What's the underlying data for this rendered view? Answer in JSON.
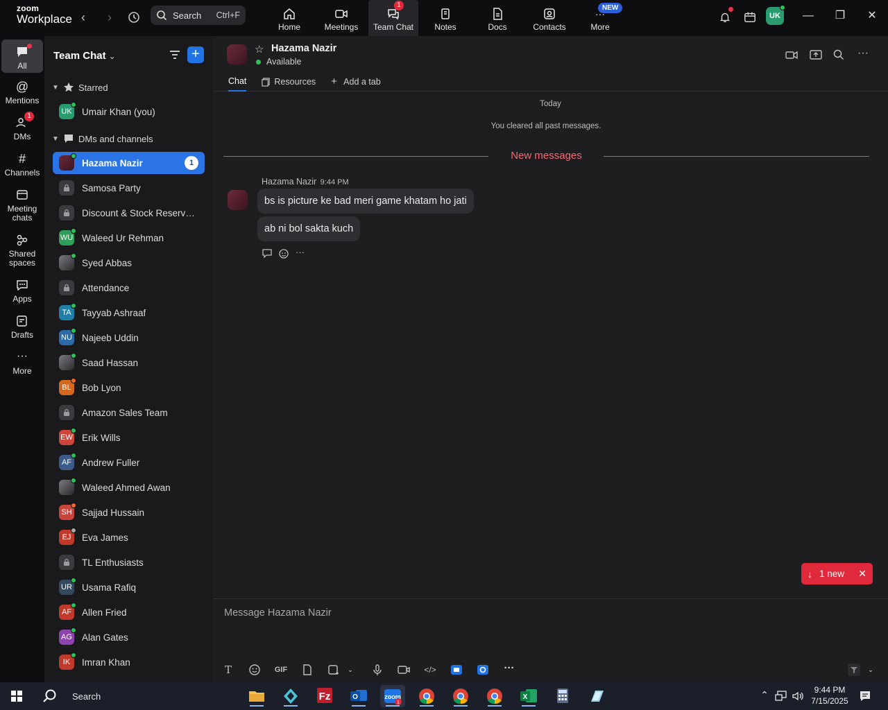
{
  "app": {
    "brand_line1": "zoom",
    "brand_line2": "Workplace"
  },
  "topbar": {
    "search_label": "Search",
    "search_shortcut": "Ctrl+F",
    "nav": [
      {
        "label": "Home",
        "icon": "home-icon"
      },
      {
        "label": "Meetings",
        "icon": "video-camera-icon"
      },
      {
        "label": "Team Chat",
        "icon": "chat-bubbles-icon",
        "badge": "1",
        "active": true
      },
      {
        "label": "Notes",
        "icon": "notes-icon"
      },
      {
        "label": "Docs",
        "icon": "document-icon"
      },
      {
        "label": "Contacts",
        "icon": "contacts-icon"
      },
      {
        "label": "More",
        "icon": "more-icon",
        "pill": "NEW"
      }
    ],
    "avatar_initials": "UK"
  },
  "rail": [
    {
      "label": "All",
      "icon": "chat-icon",
      "active": true
    },
    {
      "label": "Mentions",
      "icon": "at-icon"
    },
    {
      "label": "DMs",
      "icon": "people-icon",
      "badge": "1"
    },
    {
      "label": "Channels",
      "icon": "hash-icon"
    },
    {
      "label": "Meeting chats",
      "icon": "calendar-icon"
    },
    {
      "label": "Shared spaces",
      "icon": "shared-spaces-icon"
    },
    {
      "label": "Apps",
      "icon": "apps-icon"
    },
    {
      "label": "Drafts",
      "icon": "drafts-icon"
    },
    {
      "label": "More",
      "icon": "ellipsis-icon"
    }
  ],
  "channel_list": {
    "title": "Team Chat",
    "sections": {
      "starred": "Starred",
      "dms": "DMs and channels"
    },
    "starred": [
      {
        "name": "Umair Khan (you)",
        "initials": "UK",
        "color": "#2a9b6f",
        "status": "online"
      }
    ],
    "items": [
      {
        "name": "Hazama Nazir",
        "initials": "",
        "color": "#5a2231",
        "status": "online",
        "count": "1",
        "selected": true
      },
      {
        "name": "Samosa Party",
        "type": "lock"
      },
      {
        "name": "Discount & Stock Reservati...",
        "type": "lock"
      },
      {
        "name": "Waleed Ur Rehman",
        "initials": "WU",
        "color": "#2f9e5a",
        "status": "online"
      },
      {
        "name": "Syed Abbas",
        "initials": "",
        "color": "#333",
        "status": "online",
        "photo": true
      },
      {
        "name": "Attendance",
        "type": "lock"
      },
      {
        "name": "Tayyab Ashraaf",
        "initials": "TA",
        "color": "#1f7fa8",
        "status": "online"
      },
      {
        "name": "Najeeb Uddin",
        "initials": "NU",
        "color": "#2c6aa8",
        "status": "online"
      },
      {
        "name": "Saad Hassan",
        "initials": "",
        "color": "#3f3a45",
        "status": "online",
        "photo": true
      },
      {
        "name": "Bob Lyon",
        "initials": "BL",
        "color": "#d2691e",
        "status": "busy"
      },
      {
        "name": "Amazon Sales Team",
        "type": "lock"
      },
      {
        "name": "Erik Wills",
        "initials": "EW",
        "color": "#d0453b",
        "status": "online"
      },
      {
        "name": "Andrew Fuller",
        "initials": "AF",
        "color": "#3c5a8a",
        "status": "online"
      },
      {
        "name": "Waleed Ahmed Awan",
        "initials": "",
        "color": "#6b6b6b",
        "status": "online",
        "photo": true
      },
      {
        "name": "Sajjad Hussain",
        "initials": "SH",
        "color": "#c9453b",
        "status": "busy"
      },
      {
        "name": "Eva James",
        "initials": "EJ",
        "color": "#c0392b",
        "status": "away"
      },
      {
        "name": "TL Enthusiasts",
        "type": "lock"
      },
      {
        "name": "Usama Rafiq",
        "initials": "UR",
        "color": "#34495e",
        "status": "online"
      },
      {
        "name": "Allen Fried",
        "initials": "AF",
        "color": "#c0392b",
        "status": "online"
      },
      {
        "name": "Alan Gates",
        "initials": "AG",
        "color": "#8e44ad",
        "status": "online"
      },
      {
        "name": "Imran Khan",
        "initials": "IK",
        "color": "#c0392b",
        "status": "online"
      }
    ]
  },
  "chat": {
    "peer_name": "Hazama Nazir",
    "peer_status": "Available",
    "tabs": {
      "chat": "Chat",
      "resources": "Resources",
      "add": "Add a tab"
    },
    "date_divider": "Today",
    "system_note": "You cleared all past messages.",
    "new_divider": "New messages",
    "sender": "Hazama Nazir",
    "time": "9:44 PM",
    "messages": [
      "bs is picture ke bad meri game khatam ho jati",
      "ab ni bol sakta kuch"
    ],
    "new_pill": "1 new",
    "composer_placeholder": "Message Hazama Nazir",
    "composer_gif": "GIF"
  },
  "taskbar": {
    "search_label": "Search",
    "time": "9:44 PM",
    "date": "7/15/2025"
  },
  "colors": {
    "accent": "#2a74e5",
    "alert": "#e02a3c",
    "online": "#2fc25b"
  }
}
